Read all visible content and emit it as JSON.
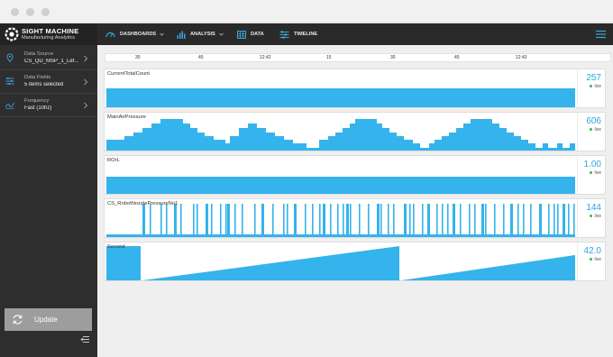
{
  "brand": {
    "name": "SIGHT MACHINE",
    "tagline": "Manufacturing Analytics"
  },
  "nav": {
    "items": [
      {
        "label": "DASHBOARDS",
        "icon": "gauge-icon",
        "has_dropdown": true
      },
      {
        "label": "ANALYSIS",
        "icon": "bar-chart-icon",
        "has_dropdown": true
      },
      {
        "label": "DATA",
        "icon": "table-icon",
        "has_dropdown": false
      },
      {
        "label": "TIMELINE",
        "icon": "timeline-icon",
        "has_dropdown": false
      }
    ]
  },
  "sidebar": {
    "items": [
      {
        "label": "Data Source",
        "value": "CS_QD_MSP_1_Lef...",
        "icon": "pin-icon"
      },
      {
        "label": "Data Fields",
        "value": "5 items selected",
        "icon": "fields-icon"
      },
      {
        "label": "Frequency",
        "value": "Fast (10hz)",
        "icon": "frequency-icon"
      }
    ],
    "update_label": "Update"
  },
  "timeline": {
    "ticks": [
      "30",
      "45",
      "12:42",
      "15",
      "30",
      "45",
      "12:43"
    ]
  },
  "colors": {
    "accent": "#29a8e0",
    "bar": "#35b3ec",
    "live": "#3bb54a"
  },
  "panels": [
    {
      "title": "CurrentTotalCount",
      "value": "257",
      "status": "live"
    },
    {
      "title": "MainAirPressure",
      "value": "606",
      "status": "live"
    },
    {
      "title": "ROrL",
      "value": "1.00",
      "status": "live"
    },
    {
      "title": "CS_RobotNozzlePressureNo1",
      "value": "144",
      "status": "live"
    },
    {
      "title": "Second",
      "value": "42.0",
      "status": "live"
    }
  ]
}
